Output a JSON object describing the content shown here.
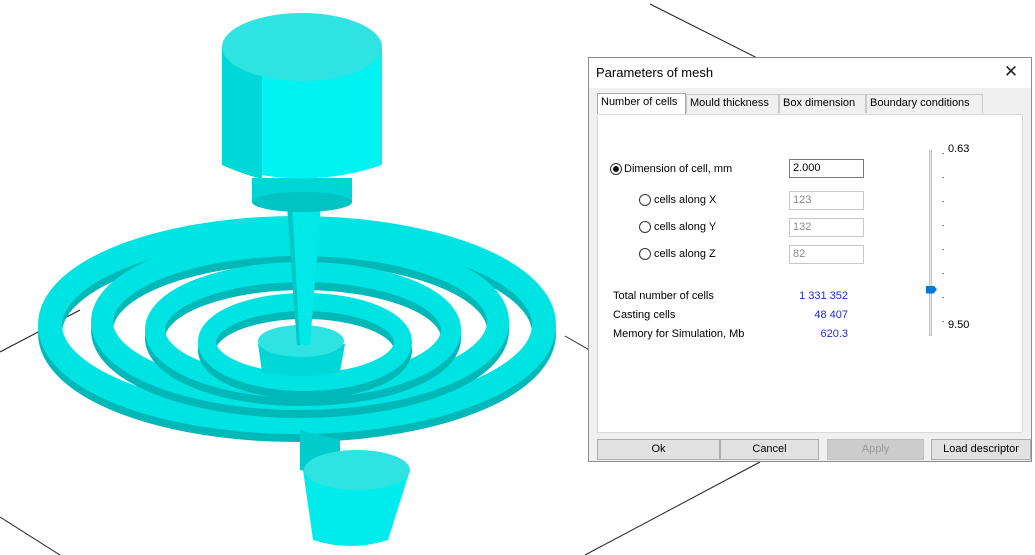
{
  "dialog": {
    "title": "Parameters of mesh",
    "close_glyph": "✕",
    "tabs": [
      {
        "label": "Number of cells",
        "active": true
      },
      {
        "label": "Mould thickness",
        "active": false
      },
      {
        "label": "Box dimension",
        "active": false
      },
      {
        "label": "Boundary conditions",
        "active": false
      }
    ],
    "dimension_option": {
      "label": "Dimension of cell, mm",
      "value": "2.000",
      "selected": true
    },
    "cells_options": [
      {
        "label": "cells along X",
        "value": "123",
        "selected": false
      },
      {
        "label": "cells along Y",
        "value": "132",
        "selected": false
      },
      {
        "label": "cells along Z",
        "value": "82",
        "selected": false
      }
    ],
    "stats": [
      {
        "label": "Total number of cells",
        "value": "1 331 352"
      },
      {
        "label": "Casting cells",
        "value": "48 407"
      },
      {
        "label": "Memory for Simulation, Mb",
        "value": "620.3"
      }
    ],
    "slider": {
      "top_label": "0.63",
      "bottom_label": "9.50",
      "thumb_fraction": 0.75
    },
    "buttons": {
      "ok": "Ok",
      "cancel": "Cancel",
      "apply": "Apply",
      "load_descriptor": "Load descriptor"
    }
  },
  "model_colors": {
    "top": "#30e3e3",
    "side_light": "#00f2f2",
    "side_dark": "#00cccc",
    "bottom": "#00b8b8"
  }
}
